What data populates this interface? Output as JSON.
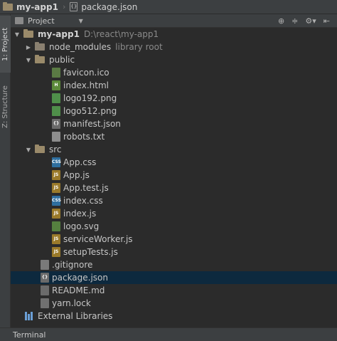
{
  "breadcrumb": {
    "project": "my-app1",
    "file": "package.json"
  },
  "left_tabs": {
    "project": "1: Project",
    "structure": "Z: Structure"
  },
  "tool_window": {
    "view_mode": "Project",
    "actions": [
      "target-icon",
      "collapse-icon",
      "gear-icon",
      "hide-icon"
    ]
  },
  "tree": {
    "root": {
      "name": "my-app1",
      "path": "D:\\react\\my-app1"
    },
    "node_modules": {
      "name": "node_modules",
      "tag": "library root"
    },
    "public": {
      "name": "public",
      "files": [
        "favicon.ico",
        "index.html",
        "logo192.png",
        "logo512.png",
        "manifest.json",
        "robots.txt"
      ]
    },
    "src": {
      "name": "src",
      "files": [
        "App.css",
        "App.js",
        "App.test.js",
        "index.css",
        "index.js",
        "logo.svg",
        "serviceWorker.js",
        "setupTests.js"
      ]
    },
    "root_files": [
      ".gitignore",
      "package.json",
      "README.md",
      "yarn.lock"
    ],
    "external": "External Libraries",
    "selected": "package.json"
  },
  "bottom": {
    "terminal": "Terminal"
  }
}
